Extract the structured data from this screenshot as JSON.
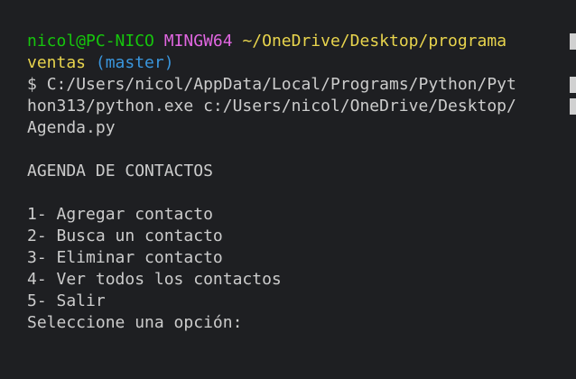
{
  "prompt": {
    "user_host": "nicol@PC-NICO",
    "env": "MINGW64",
    "path_line1": "~/OneDrive/Desktop/programa",
    "path_line2": "ventas",
    "branch": "(master)"
  },
  "command": {
    "symbol": "$",
    "line1": "C:/Users/nicol/AppData/Local/Programs/Python/Pyt",
    "line2": "hon313/python.exe c:/Users/nicol/OneDrive/Desktop/",
    "line3": "Agenda.py"
  },
  "output": {
    "title": "AGENDA DE CONTACTOS",
    "menu": [
      "1- Agregar contacto",
      "2- Busca un contacto",
      "3- Eliminar contacto",
      "4- Ver todos los contactos",
      "5- Salir"
    ],
    "input_prompt": "Seleccione una opción:"
  },
  "colors": {
    "background": "#1e1f22",
    "text": "#cccccc",
    "user_host": "#16c60c",
    "env": "#e066e0",
    "path": "#e8d44d",
    "branch": "#3a96dd"
  }
}
